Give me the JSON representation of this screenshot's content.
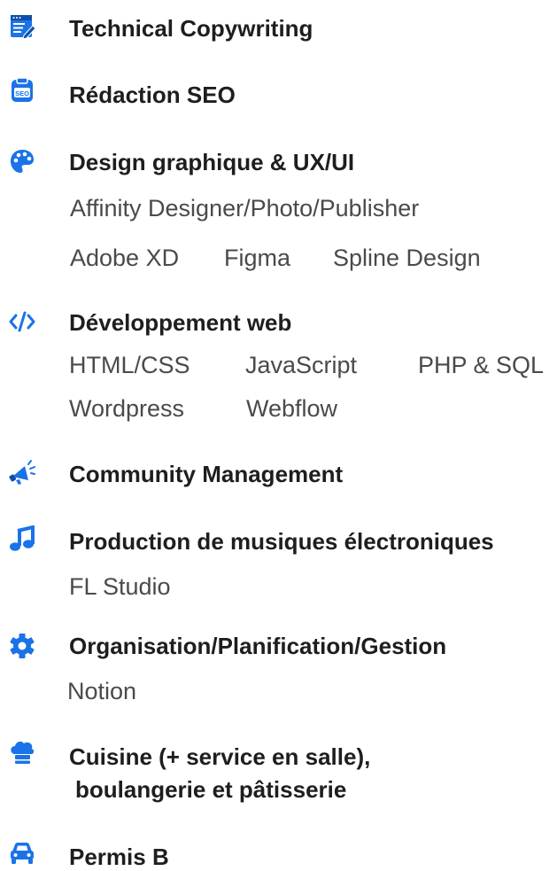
{
  "skills": [
    {
      "icon": "form-icon",
      "title": "Technical Copywriting"
    },
    {
      "icon": "seo-icon",
      "title": "Rédaction SEO"
    },
    {
      "icon": "palette-icon",
      "title": "Design graphique & UX/UI",
      "rows": [
        [
          "Affinity Designer/Photo/Publisher"
        ],
        [
          "Adobe XD",
          "Figma",
          "Spline Design"
        ]
      ]
    },
    {
      "icon": "code-icon",
      "title": "Développement web",
      "rows": [
        [
          "HTML/CSS",
          "JavaScript",
          "PHP & SQL"
        ],
        [
          "Wordpress",
          "Webflow"
        ]
      ]
    },
    {
      "icon": "megaphone-icon",
      "title": "Community Management"
    },
    {
      "icon": "music-icon",
      "title": "Production de musiques électroniques",
      "rows": [
        [
          "FL Studio"
        ]
      ]
    },
    {
      "icon": "gear-icon",
      "title": "Organisation/Planification/Gestion",
      "rows": [
        [
          "Notion"
        ]
      ]
    },
    {
      "icon": "chef-hat-icon",
      "title": "Cuisine (+ service en salle),",
      "title_line2": "boulangerie et pâtisserie"
    },
    {
      "icon": "car-icon",
      "title": "Permis B"
    }
  ],
  "colors": {
    "icon": "#1a73e8",
    "text": "#1e1e1e",
    "sub": "#4a4a4a"
  }
}
